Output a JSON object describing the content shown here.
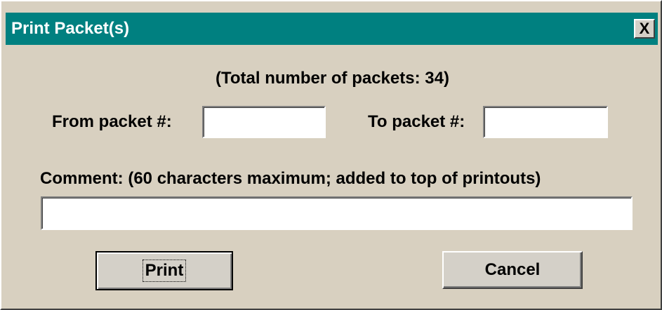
{
  "window": {
    "title": "Print Packet(s)",
    "close_label": "X"
  },
  "total_text": "(Total number of packets: 34)",
  "range": {
    "from_label": "From packet #:",
    "from_value": "",
    "to_label": "To packet #:",
    "to_value": ""
  },
  "comment": {
    "label": "Comment: (60 characters maximum; added to top of printouts)",
    "value": ""
  },
  "buttons": {
    "print_label": "Print",
    "cancel_label": "Cancel"
  }
}
